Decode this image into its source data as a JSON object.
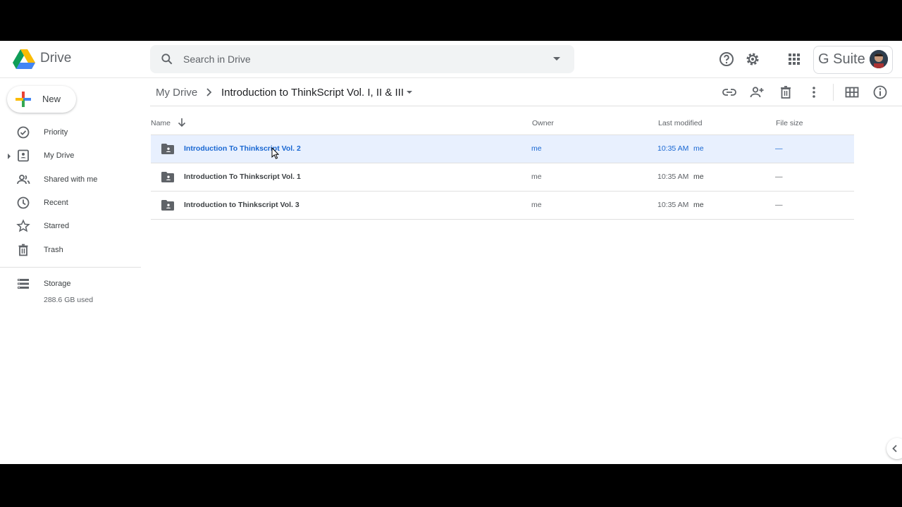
{
  "app": {
    "name": "Drive",
    "brand": "G Suite"
  },
  "search": {
    "placeholder": "Search in Drive"
  },
  "sidebar": {
    "new_label": "New",
    "items": [
      {
        "label": "Priority",
        "icon": "priority-icon"
      },
      {
        "label": "My Drive",
        "icon": "my-drive-icon"
      },
      {
        "label": "Shared with me",
        "icon": "shared-icon"
      },
      {
        "label": "Recent",
        "icon": "clock-icon"
      },
      {
        "label": "Starred",
        "icon": "star-icon"
      },
      {
        "label": "Trash",
        "icon": "trash-icon"
      }
    ],
    "storage": {
      "label": "Storage",
      "used": "288.6 GB used"
    }
  },
  "breadcrumb": {
    "root": "My Drive",
    "current": "Introduction to ThinkScript Vol. I, II & III"
  },
  "table": {
    "columns": {
      "name": "Name",
      "owner": "Owner",
      "modified": "Last modified",
      "size": "File size"
    },
    "rows": [
      {
        "name": "Introduction To Thinkscript Vol. 2",
        "owner": "me",
        "time": "10:35 AM",
        "modifier": "me",
        "size": "—",
        "selected": true
      },
      {
        "name": "Introduction To Thinkscript Vol. 1",
        "owner": "me",
        "time": "10:35 AM",
        "modifier": "me",
        "size": "—",
        "selected": false
      },
      {
        "name": "Introduction to Thinkscript Vol. 3",
        "owner": "me",
        "time": "10:35 AM",
        "modifier": "me",
        "size": "—",
        "selected": false
      }
    ]
  },
  "colors": {
    "accent": "#1967d2",
    "selected_row": "#e8f0fe",
    "icon": "#5f6368"
  }
}
